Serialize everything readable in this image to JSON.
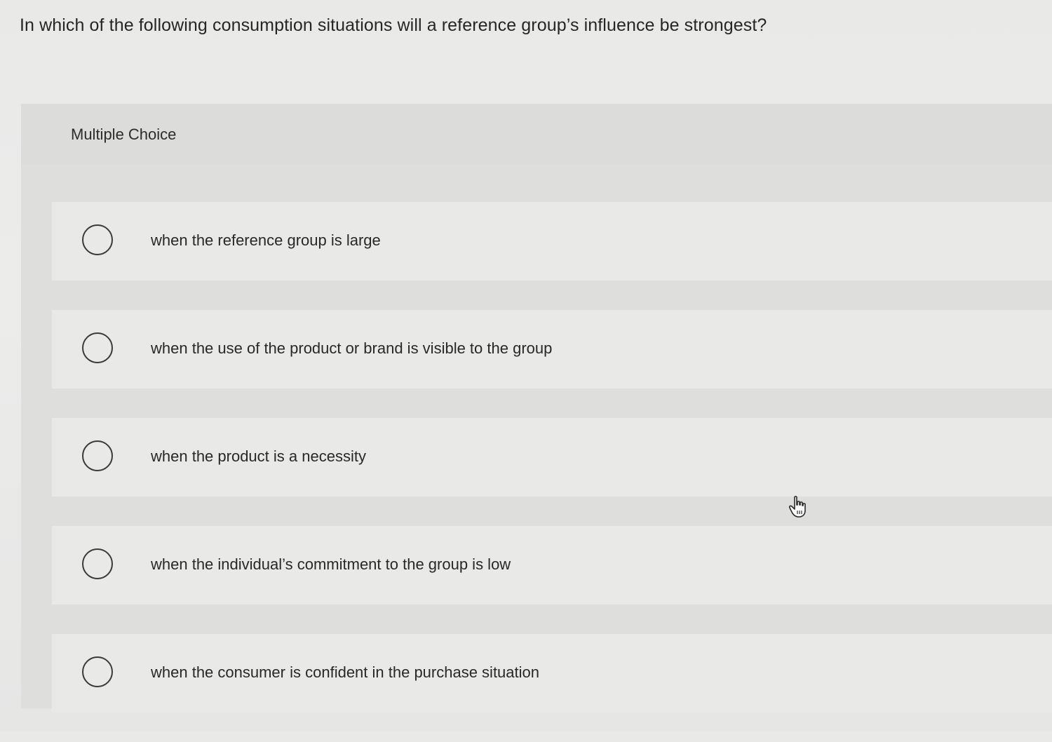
{
  "question": {
    "text": "In which of the following consumption situations will a reference group’s influence be strongest?"
  },
  "multiple_choice": {
    "label": "Multiple Choice",
    "options": [
      {
        "label": "when the reference group is large",
        "selected": false
      },
      {
        "label": "when the use of the product or brand is visible to the group",
        "selected": false
      },
      {
        "label": "when the product is a necessity",
        "selected": false
      },
      {
        "label": "when the individual’s commitment to the group is low",
        "selected": false
      },
      {
        "label": "when the consumer is confident in the purchase situation",
        "selected": false
      }
    ]
  },
  "icons": {
    "option_radio": "radio-button-icon",
    "pointer": "hand-pointer-icon"
  }
}
